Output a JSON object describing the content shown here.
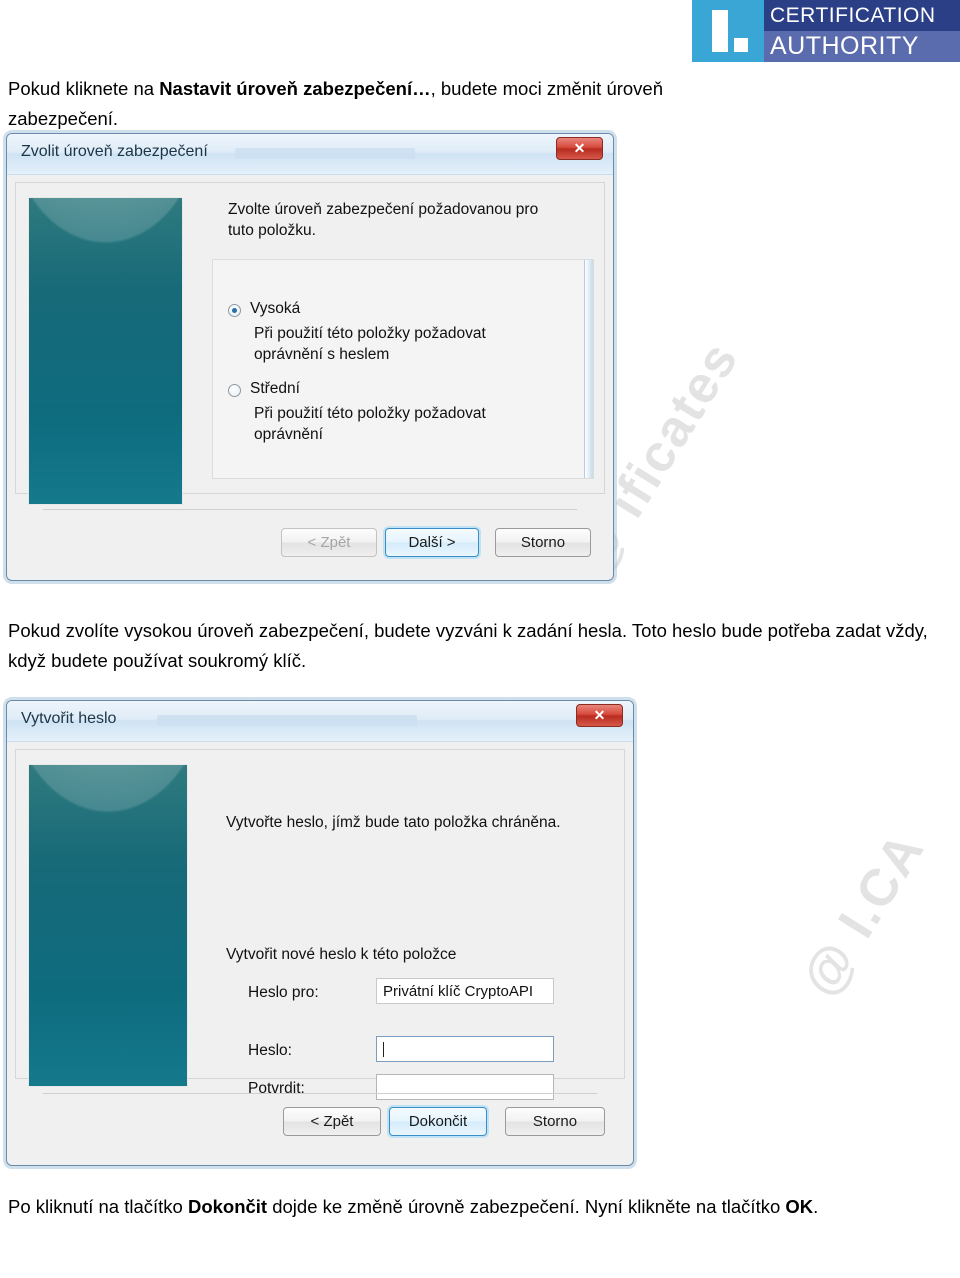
{
  "logo": {
    "line1": "CERTIFICATION",
    "line2": "AUTHORITY",
    "mark_color": "#3aa6d6",
    "line1_color": "#2b3f87",
    "line2_color": "#5a6cae"
  },
  "watermark": {
    "text_1": "@ ificates",
    "text_2": "@ I.CA"
  },
  "paragraphs": {
    "top_prefix": "Pokud kliknete na ",
    "top_bold": "Nastavit úroveň zabezpečení…",
    "top_suffix": ", budete moci změnit úroveň zabezpečení.",
    "middle": "Pokud zvolíte vysokou úroveň zabezpečení, budete vyzváni k zadání hesla. Toto heslo bude potřeba zadat vždy, když budete používat soukromý klíč.",
    "bottom_prefix": "Po kliknutí na tlačítko ",
    "bottom_bold_1": "Dokončit",
    "bottom_middle": " dojde ke změně úrovně zabezpečení.  Nyní klikněte na tlačítko ",
    "bottom_bold_2": "OK",
    "bottom_suffix": "."
  },
  "dialog_security_level": {
    "title": "Zvolit úroveň zabezpečení",
    "close_label": "✕",
    "instruction": "Zvolte úroveň zabezpečení požadovanou pro tuto položku.",
    "options": [
      {
        "label": "Vysoká",
        "description": "Při použití této položky požadovat oprávnění s heslem",
        "selected": true
      },
      {
        "label": "Střední",
        "description": "Při použití této položky požadovat oprávnění",
        "selected": false
      }
    ],
    "buttons": {
      "back": "< Zpět",
      "next": "Další >",
      "cancel": "Storno"
    }
  },
  "dialog_create_password": {
    "title": "Vytvořit heslo",
    "close_label": "✕",
    "instruction": "Vytvořte heslo, jímž bude tato položka chráněna.",
    "group_label": "Vytvořit nové heslo k této položce",
    "fields": [
      {
        "label": "Heslo pro:",
        "value": "Privátní klíč CryptoAPI"
      },
      {
        "label": "Heslo:",
        "value": ""
      },
      {
        "label": "Potvrdit:",
        "value": ""
      }
    ],
    "buttons": {
      "back": "< Zpět",
      "finish": "Dokončit",
      "cancel": "Storno"
    }
  }
}
